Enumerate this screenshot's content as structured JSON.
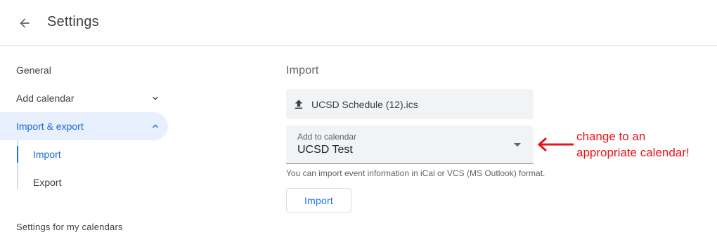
{
  "header": {
    "title": "Settings"
  },
  "sidebar": {
    "items": [
      {
        "label": "General"
      },
      {
        "label": "Add calendar"
      },
      {
        "label": "Import & export"
      }
    ],
    "sub_items": [
      {
        "label": "Import"
      },
      {
        "label": "Export"
      }
    ],
    "section_title": "Settings for my calendars"
  },
  "main": {
    "heading": "Import",
    "file": {
      "name": "UCSD Schedule (12).ics"
    },
    "calendar_select": {
      "label": "Add to calendar",
      "value": "UCSD Test"
    },
    "helper_text": "You can import event information in iCal or VCS (MS Outlook) format.",
    "import_button": "Import"
  },
  "annotation": {
    "line1": "change to an",
    "line2": "appropriate calendar!",
    "color": "#e8141e"
  },
  "colors": {
    "accent": "#1a73e8",
    "active_bg": "#e8f0fe"
  }
}
